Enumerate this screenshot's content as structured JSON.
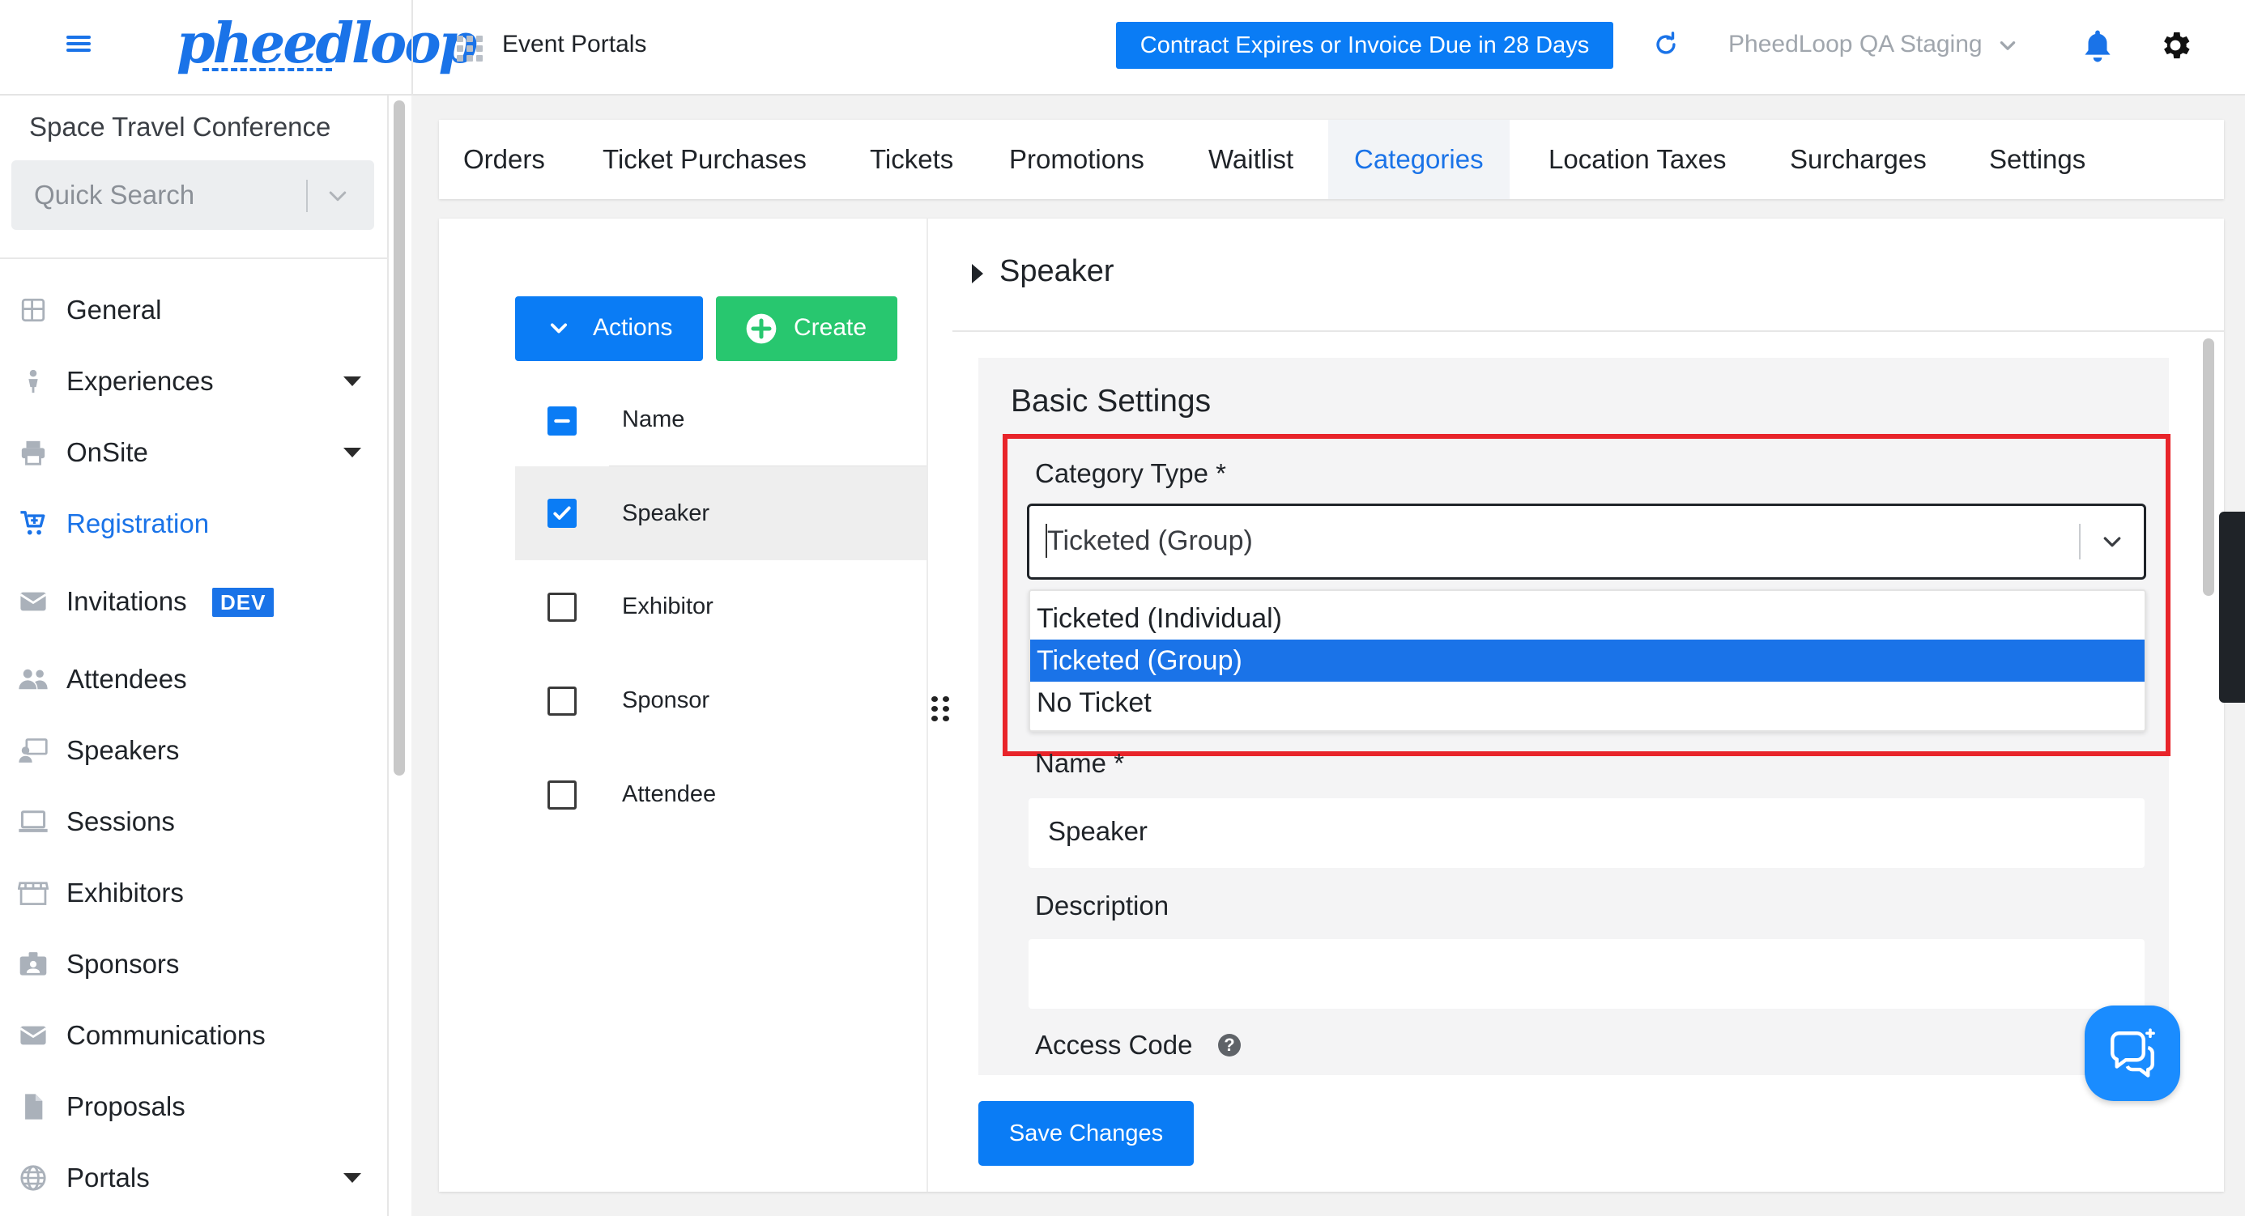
{
  "topbar": {
    "event_portals_label": "Event Portals",
    "contract_banner": "Contract Expires or Invoice Due in 28 Days",
    "org_name": "PheedLoop QA Staging",
    "brand_color": "#1a73e8"
  },
  "sidebar": {
    "conference_name": "Space Travel Conference",
    "quick_search_placeholder": "Quick Search",
    "items": [
      {
        "label": "General",
        "icon": "grid-icon"
      },
      {
        "label": "Experiences",
        "icon": "person-icon"
      },
      {
        "label": "OnSite",
        "icon": "printer-icon"
      },
      {
        "label": "Registration",
        "icon": "cart-icon"
      },
      {
        "label": "Invitations",
        "icon": "envelope-icon",
        "badge": "DEV"
      },
      {
        "label": "Attendees",
        "icon": "people-icon"
      },
      {
        "label": "Speakers",
        "icon": "speaker-icon"
      },
      {
        "label": "Sessions",
        "icon": "laptop-icon"
      },
      {
        "label": "Exhibitors",
        "icon": "store-icon"
      },
      {
        "label": "Sponsors",
        "icon": "badge-icon"
      },
      {
        "label": "Communications",
        "icon": "mail-icon"
      },
      {
        "label": "Proposals",
        "icon": "document-icon"
      },
      {
        "label": "Portals",
        "icon": "globe-icon"
      }
    ]
  },
  "tabs": [
    "Orders",
    "Ticket Purchases",
    "Tickets",
    "Promotions",
    "Waitlist",
    "Categories",
    "Location Taxes",
    "Surcharges",
    "Settings"
  ],
  "list": {
    "actions_label": "Actions",
    "create_label": "Create",
    "column_name": "Name",
    "rows": [
      "Speaker",
      "Exhibitor",
      "Sponsor",
      "Attendee"
    ]
  },
  "detail": {
    "title": "Speaker",
    "section_heading": "Basic Settings",
    "category_type_label": "Category Type *",
    "category_type_value": "Ticketed (Group)",
    "options": [
      "Ticketed (Individual)",
      "Ticketed (Group)",
      "No Ticket"
    ],
    "name_label": "Name *",
    "name_value": "Speaker",
    "description_label": "Description",
    "description_value": "",
    "access_code_label": "Access Code",
    "save_label": "Save Changes"
  }
}
